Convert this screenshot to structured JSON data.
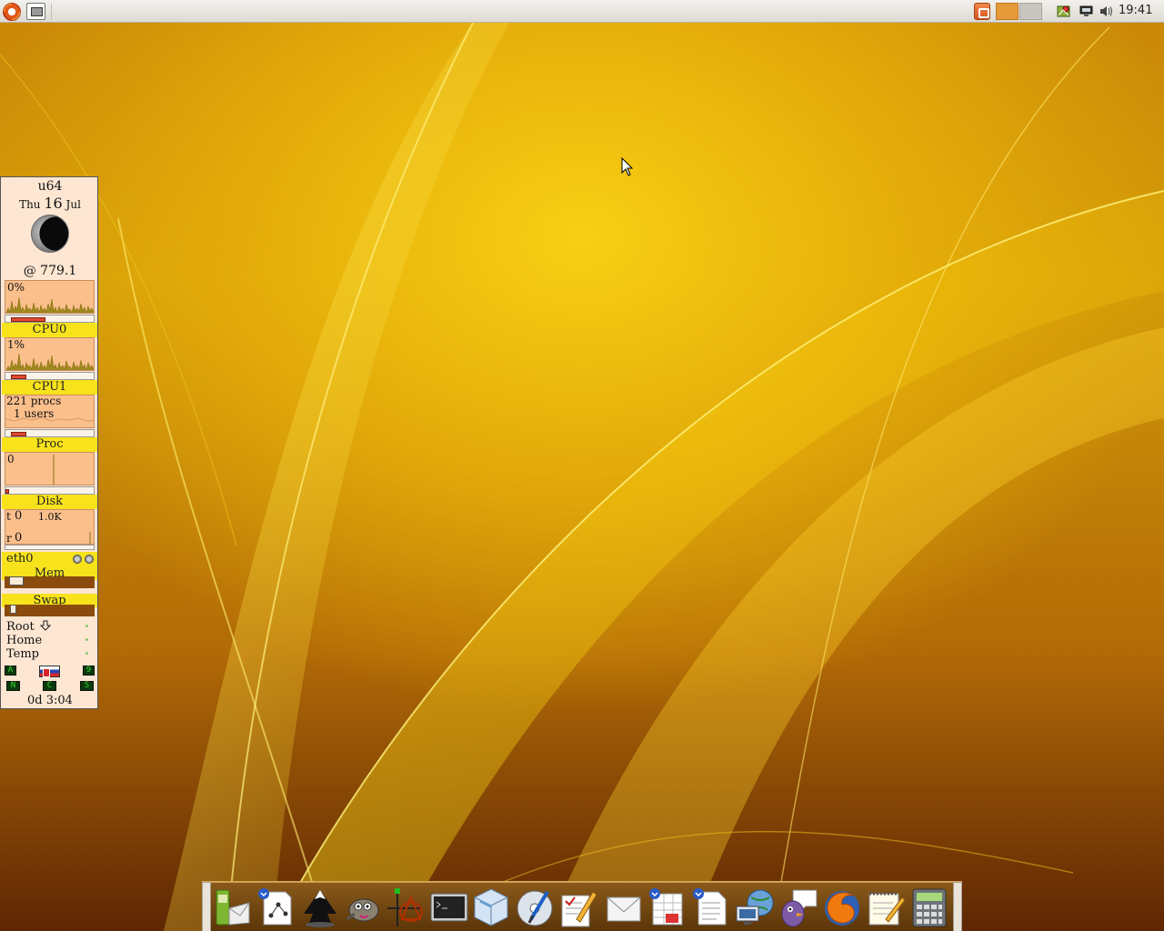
{
  "top_panel": {
    "clock": "19:41",
    "main_menu_icon": "ubuntu-logo-icon",
    "show_desktop_icon": "show-desktop-icon",
    "tray_icons": [
      "update-notifier-icon",
      "workspace-1",
      "workspace-2",
      "network-manager-icon",
      "network-monitor-icon",
      "volume-icon"
    ]
  },
  "monitor": {
    "hostname": "u64",
    "weekday": "Thu",
    "day": "16",
    "month": "Jul",
    "moon_icon": "moon-phase-icon",
    "internet_time": "@ 779.1",
    "cpu0": {
      "percent": "0%",
      "label": "CPU0",
      "load_fraction": 0.45
    },
    "cpu1": {
      "percent": "1%",
      "label": "CPU1",
      "load_fraction": 0.2
    },
    "proc": {
      "procs": "221 procs",
      "users": "1 users",
      "label": "Proc",
      "load_fraction": 0.2
    },
    "disk": {
      "value": "0",
      "label": "Disk"
    },
    "net": {
      "tx_label": "t",
      "tx_value": "0",
      "scale": "1.0K",
      "rx_label": "r",
      "rx_value": "0",
      "label": "eth0"
    },
    "mem": {
      "label": "Mem",
      "usage_fraction": 0.16
    },
    "swap": {
      "label": "Swap",
      "usage_fraction": 0.05
    },
    "filesystems": [
      {
        "name": "Root"
      },
      {
        "name": "Home"
      },
      {
        "name": "Temp"
      }
    ],
    "keyboard_leds": {
      "a": "A",
      "n": "N",
      "c": "C",
      "s": "S",
      "nine": "9"
    },
    "uptime": "0d  3:04"
  },
  "dock": {
    "items": [
      {
        "name": "phone-manager-icon"
      },
      {
        "name": "graph-editor-icon"
      },
      {
        "name": "inkscape-icon"
      },
      {
        "name": "gimp-icon"
      },
      {
        "name": "diagram-tool-icon"
      },
      {
        "name": "terminal-icon"
      },
      {
        "name": "virtualbox-icon"
      },
      {
        "name": "cd-burner-icon"
      },
      {
        "name": "text-editor-pen-icon"
      },
      {
        "name": "mail-icon"
      },
      {
        "name": "spreadsheet-icon"
      },
      {
        "name": "document-icon"
      },
      {
        "name": "network-places-icon"
      },
      {
        "name": "pidgin-icon"
      },
      {
        "name": "firefox-icon"
      },
      {
        "name": "notepad-icon"
      },
      {
        "name": "calculator-icon"
      }
    ]
  }
}
